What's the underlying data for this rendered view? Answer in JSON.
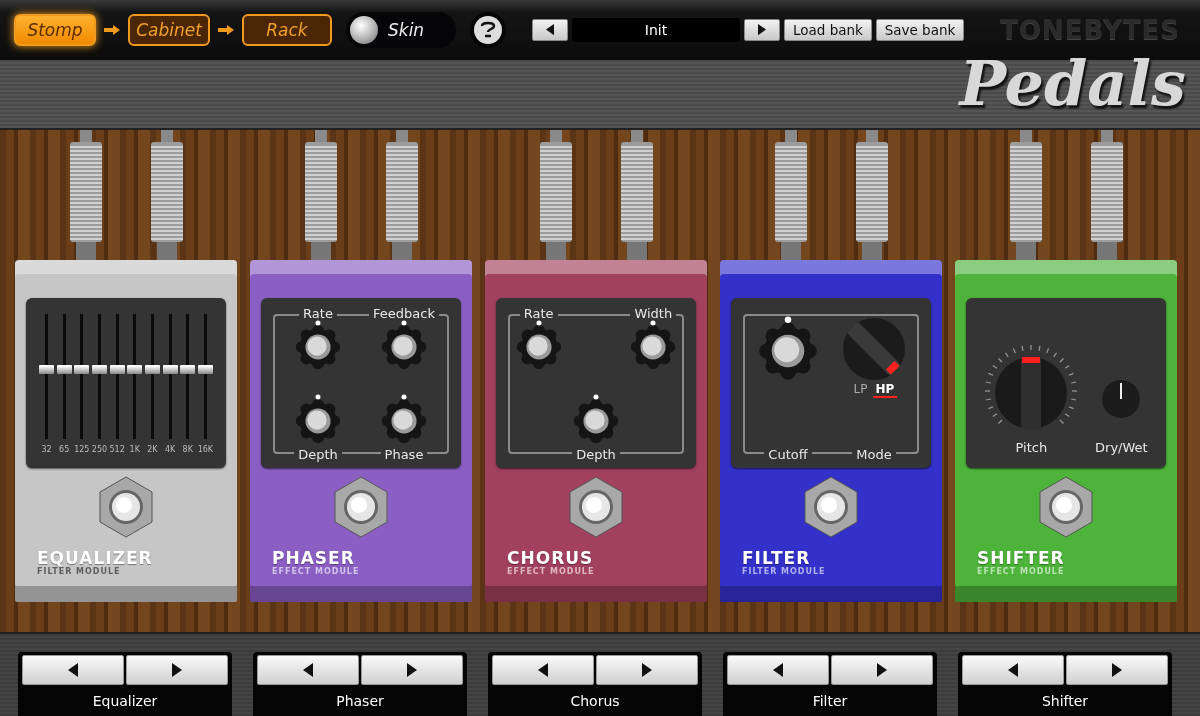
{
  "modes": [
    {
      "label": "Stomp",
      "selected": true
    },
    {
      "label": "Cabinet",
      "selected": false
    },
    {
      "label": "Rack",
      "selected": false
    }
  ],
  "skin": {
    "label": "Skin"
  },
  "preset": {
    "name": "Init"
  },
  "bank_buttons": [
    "Load bank",
    "Save bank"
  ],
  "brand": {
    "maker": "TONEBYTES",
    "product": "Pedals"
  },
  "pedals": [
    {
      "kind": "equalizer",
      "name": "EQUALIZER",
      "subtitle": "FILTER MODULE",
      "color": "#c6c6c6",
      "bands": [
        {
          "label": "32",
          "level": 0.56
        },
        {
          "label": "65",
          "level": 0.56
        },
        {
          "label": "125",
          "level": 0.56
        },
        {
          "label": "250",
          "level": 0.56
        },
        {
          "label": "512",
          "level": 0.56
        },
        {
          "label": "1K",
          "level": 0.56
        },
        {
          "label": "2K",
          "level": 0.56
        },
        {
          "label": "4K",
          "level": 0.56
        },
        {
          "label": "8K",
          "level": 0.56
        },
        {
          "label": "16K",
          "level": 0.56
        }
      ]
    },
    {
      "kind": "quad",
      "name": "PHASER",
      "subtitle": "EFFECT MODULE",
      "color": "#8b5ec4",
      "knobs": [
        {
          "label": "Rate"
        },
        {
          "label": "Feedback"
        },
        {
          "label": "Depth"
        },
        {
          "label": "Phase"
        }
      ]
    },
    {
      "kind": "trio",
      "name": "CHORUS",
      "subtitle": "EFFECT MODULE",
      "color": "#a2405f",
      "knobs": [
        {
          "label": "Rate"
        },
        {
          "label": "Depth"
        },
        {
          "label": "Width"
        }
      ]
    },
    {
      "kind": "filter",
      "name": "FILTER",
      "subtitle": "FILTER MODULE",
      "color": "#3331c9",
      "knobs": [
        {
          "label": "Cutoff"
        }
      ],
      "mode": {
        "label": "Mode",
        "options": [
          {
            "label": "LP",
            "selected": false
          },
          {
            "label": "HP",
            "selected": true
          }
        ]
      }
    },
    {
      "kind": "shifter",
      "name": "SHIFTER",
      "subtitle": "EFFECT MODULE",
      "color": "#4db33a",
      "knobs": [
        {
          "label": "Pitch"
        },
        {
          "label": "Dry/Wet"
        }
      ]
    }
  ],
  "slots": [
    {
      "label": "Equalizer"
    },
    {
      "label": "Phaser"
    },
    {
      "label": "Chorus"
    },
    {
      "label": "Filter"
    },
    {
      "label": "Shifter"
    }
  ]
}
